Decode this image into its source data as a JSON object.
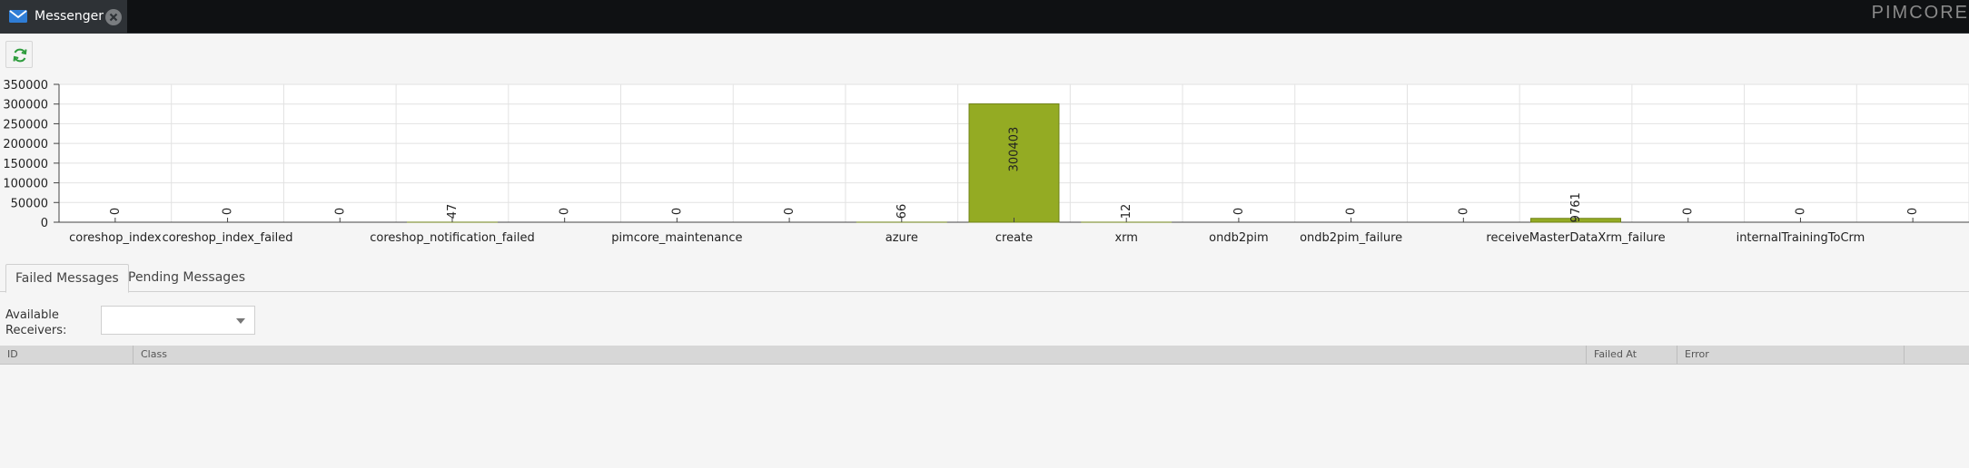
{
  "tab": {
    "title": "Messenger",
    "icon": "mail-icon",
    "close_icon": "close-icon"
  },
  "logo": {
    "text": "PIMCORE"
  },
  "toolbar": {
    "refresh_icon": "refresh-icon"
  },
  "chart_data": {
    "type": "bar",
    "categories": [
      "coreshop_index",
      "coreshop_index_failed",
      "",
      "coreshop_notification_failed",
      "",
      "pimcore_maintenance",
      "",
      "azure",
      "create",
      "xrm",
      "ondb2pim",
      "ondb2pim_failure",
      "",
      "receiveMasterDataXrm_failure",
      "",
      "internalTrainingToCrm",
      ""
    ],
    "values": [
      0,
      0,
      0,
      47,
      0,
      0,
      0,
      66,
      300403,
      12,
      0,
      0,
      0,
      9761,
      0,
      0,
      0
    ],
    "data_labels": [
      "0",
      "0",
      "0",
      "47",
      "0",
      "0",
      "0",
      "66",
      "300403",
      "12",
      "0",
      "0",
      "0",
      "9761",
      "0",
      "0",
      "0"
    ],
    "yticks": [
      "0",
      "50000",
      "100000",
      "150000",
      "200000",
      "250000",
      "300000",
      "350000"
    ],
    "ylim": [
      0,
      350000
    ],
    "grid": true,
    "bar_color": "#94ab23",
    "bar_border": "#6f8216",
    "title": "",
    "xlabel": "",
    "ylabel": ""
  },
  "panel_tabs": [
    {
      "label": "Failed Messages",
      "active": true
    },
    {
      "label": "Pending Messages",
      "active": false
    }
  ],
  "receivers": {
    "label": "Available Receivers:",
    "value": ""
  },
  "grid": {
    "columns": [
      "ID",
      "Class",
      "Failed At",
      "Error"
    ]
  },
  "colors": {
    "topbar": "#0f1113",
    "accent_green": "#94ab23",
    "tab_bg": "#2e3236"
  }
}
